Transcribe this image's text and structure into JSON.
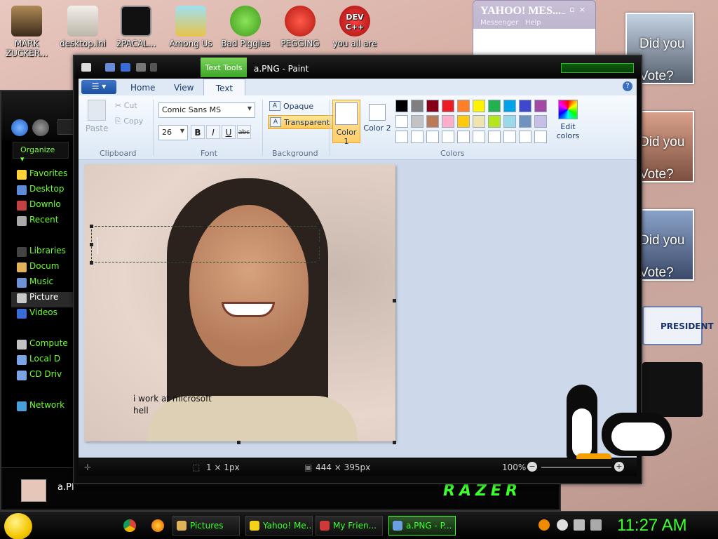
{
  "desktop": {
    "icons": [
      {
        "label": "MARK ZUCKER...",
        "icon": "book-person-icon",
        "color": "#6a4a2a"
      },
      {
        "label": "desktop.ini",
        "icon": "settings-file-icon",
        "color": "#d9d3c9"
      },
      {
        "label": "2PACAL...",
        "icon": "terminal-icon",
        "color": "#111111"
      },
      {
        "label": "Among Us",
        "icon": "folder-shortcut-icon",
        "color": "#7fd0e6"
      },
      {
        "label": "Bad Piggies",
        "icon": "pig-icon",
        "color": "#5cc12a"
      },
      {
        "label": "PEGGING",
        "icon": "letter-p-icon",
        "color": "#d9322a"
      },
      {
        "label": "you all are",
        "icon": "devcpp-icon",
        "color": "#c9202a"
      }
    ],
    "devcpp_text": "DEV C++",
    "side_photos": [
      "Did you Vote?",
      "Did you Vote?",
      "Did you Vote?"
    ],
    "side_banner": "PRESIDENT"
  },
  "yahoo": {
    "title": "YAHOO! MES...",
    "subtitle_left": "Messenger",
    "subtitle_right": "Help"
  },
  "explorer": {
    "organize": "Organize",
    "tree": [
      {
        "label": "Favorites",
        "icon": "star-icon",
        "color": "#ffd23a"
      },
      {
        "label": "Desktop",
        "icon": "desktop-icon",
        "color": "#5d8bd6"
      },
      {
        "label": "Downlo",
        "icon": "downloads-icon",
        "color": "#c14242"
      },
      {
        "label": "Recent",
        "icon": "recent-icon",
        "color": "#aaaaaa"
      },
      {
        "label": "",
        "icon": "",
        "color": ""
      },
      {
        "label": "Libraries",
        "icon": "library-icon",
        "color": "#444444"
      },
      {
        "label": "Docum",
        "icon": "documents-icon",
        "color": "#e0b35a"
      },
      {
        "label": "Music",
        "icon": "music-icon",
        "color": "#6f92d6"
      },
      {
        "label": "Picture",
        "icon": "pictures-icon",
        "color": "#c9c9c9"
      },
      {
        "label": "Videos",
        "icon": "videos-icon",
        "color": "#3b6bd6"
      },
      {
        "label": "",
        "icon": "",
        "color": ""
      },
      {
        "label": "Compute",
        "icon": "computer-icon",
        "color": "#c2c2c2"
      },
      {
        "label": "Local D",
        "icon": "drive-icon",
        "color": "#7aa6e6"
      },
      {
        "label": "CD Driv",
        "icon": "cd-drive-icon",
        "color": "#7aa6e6"
      },
      {
        "label": "",
        "icon": "",
        "color": ""
      },
      {
        "label": "Network",
        "icon": "network-icon",
        "color": "#4aa0d6"
      }
    ],
    "selected_index": 8,
    "footer_file": "a.Pl",
    "brand": "RAZER"
  },
  "paint": {
    "title": "a.PNG - Paint",
    "context_tab": "Text Tools",
    "tabs": [
      "Home",
      "View",
      "Text"
    ],
    "active_tab": "Text",
    "clipboard": {
      "paste": "Paste",
      "cut": "Cut",
      "copy": "Copy",
      "label": "Clipboard"
    },
    "font": {
      "family": "Comic Sans MS",
      "size": "26",
      "bold": "B",
      "italic": "I",
      "underline": "U",
      "strike": "abc",
      "label": "Font"
    },
    "background": {
      "opaque": "Opaque",
      "transparent": "Transparent",
      "label": "Background",
      "selected": "Transparent"
    },
    "colors": {
      "color1": "Color 1",
      "color2": "Color 2",
      "edit": "Edit colors",
      "label": "Colors",
      "palette": [
        "#000000",
        "#7f7f7f",
        "#880015",
        "#ed1c24",
        "#ff7f27",
        "#fff200",
        "#22b14c",
        "#00a2e8",
        "#3f48cc",
        "#a349a4",
        "#ffffff",
        "#c3c3c3",
        "#b97a57",
        "#ffaec9",
        "#ffc90e",
        "#efe4b0",
        "#b5e61d",
        "#99d9ea",
        "#7092be",
        "#c8bfe7",
        "#ffffff",
        "#ffffff",
        "#ffffff",
        "#ffffff",
        "#ffffff",
        "#ffffff",
        "#ffffff",
        "#ffffff",
        "#ffffff",
        "#ffffff"
      ]
    },
    "canvas": {
      "caption_line1": "i work at microsoft",
      "caption_line2": "hell"
    },
    "status": {
      "selection": "1 × 1px",
      "image_size": "444 × 395px",
      "zoom": "100%"
    }
  },
  "taskbar": {
    "buttons": [
      {
        "label": "Pictures",
        "icon": "folder-icon",
        "color": "#e0b35a"
      },
      {
        "label": "Yahoo! Me...",
        "icon": "yahoo-smiley-icon",
        "color": "#f4d21a"
      },
      {
        "label": "My Frien...",
        "icon": "friends-icon",
        "color": "#cc3a3a"
      },
      {
        "label": "a.PNG - P...",
        "icon": "paint-icon",
        "color": "#6aa0e0"
      }
    ],
    "active_index": 3,
    "time": "11:27 AM"
  }
}
